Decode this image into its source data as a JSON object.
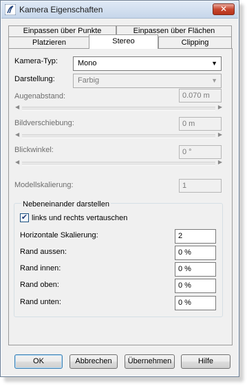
{
  "window": {
    "title": "Kamera Eigenschaften",
    "close_label": "✕"
  },
  "tabs": {
    "row_back": [
      "Einpassen über Punkte",
      "Einpassen über Flächen"
    ],
    "row_front": [
      "Platzieren",
      "Stereo",
      "Clipping"
    ],
    "active": "Stereo"
  },
  "stereo": {
    "camera_type": {
      "label": "Kamera-Typ:",
      "value": "Mono"
    },
    "display": {
      "label": "Darstellung:",
      "value": "Farbig"
    },
    "eye_distance": {
      "label": "Augenabstand:",
      "value": "0.070 m"
    },
    "image_shift": {
      "label": "Bildverschiebung:",
      "value": "0 m"
    },
    "view_angle": {
      "label": "Blickwinkel:",
      "value": "0 °"
    },
    "model_scale": {
      "label": "Modellskalierung:",
      "value": "1"
    },
    "side_by_side": {
      "title": "Nebeneinander darstellen",
      "swap_label": "links und rechts vertauschen",
      "swap_checked": true,
      "horizontal_scale": {
        "label": "Horizontale Skalierung:",
        "value": "2"
      },
      "outer_margin": {
        "label": "Rand aussen:",
        "value": "0 %"
      },
      "inner_margin": {
        "label": "Rand innen:",
        "value": "0 %"
      },
      "top_margin": {
        "label": "Rand oben:",
        "value": "0 %"
      },
      "bottom_margin": {
        "label": "Rand unten:",
        "value": "0 %"
      }
    }
  },
  "buttons": {
    "ok": "OK",
    "cancel": "Abbrechen",
    "apply": "Übernehmen",
    "help": "Hilfe"
  },
  "icons": {
    "app": "rhino-camera-icon",
    "check": "✔",
    "dropdown": "▼",
    "scroll_left": "◀",
    "scroll_right": "▶"
  }
}
